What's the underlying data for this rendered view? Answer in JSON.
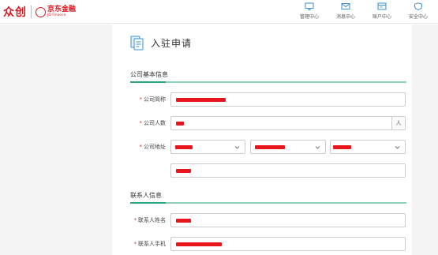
{
  "header": {
    "brand_primary": "众创",
    "brand_partner_cn": "京东金融",
    "brand_partner_en": "JD Finance",
    "nav": [
      {
        "label": "管理中心",
        "icon": "monitor-icon"
      },
      {
        "label": "消息中心",
        "icon": "mail-icon"
      },
      {
        "label": "账户中心",
        "icon": "account-icon"
      },
      {
        "label": "安全中心",
        "icon": "shield-icon"
      }
    ]
  },
  "page": {
    "title": "入驻申请",
    "title_icon": "application-document-icon"
  },
  "sections": {
    "company": {
      "title": "公司基本信息",
      "fields": {
        "name_label": "公司简称",
        "headcount_label": "公司人数",
        "headcount_suffix": "人",
        "address_label": "公司地址"
      }
    },
    "contact": {
      "title": "联系人信息",
      "fields": {
        "name_label": "联系人姓名",
        "phone_label": "联系人手机"
      }
    }
  },
  "colors": {
    "accent": "#2aa683",
    "accent_light": "#8fd1b8",
    "brand_red": "#d71920",
    "redaction": "#e8161c",
    "required_star": "#e03030"
  },
  "required_mark": "*"
}
